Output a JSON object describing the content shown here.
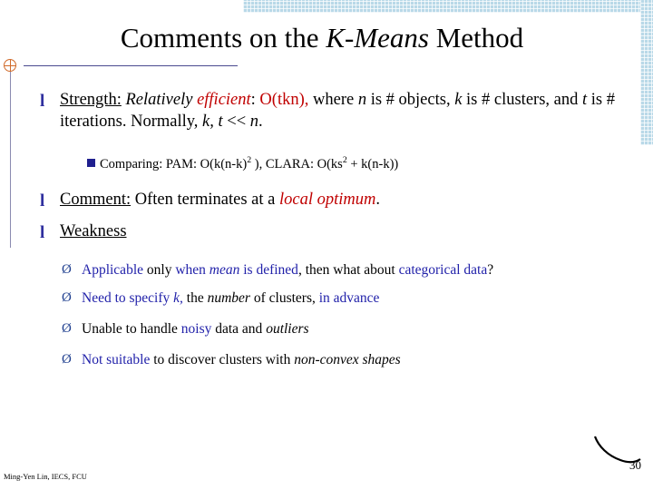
{
  "slide": {
    "title": {
      "part1": "Comments on the ",
      "part2_italic": "K-Means",
      "part3": " Method"
    },
    "bullets": [
      {
        "marker": "l",
        "segments": [
          {
            "text": "Strength:",
            "style": "underline"
          },
          {
            "text": " ",
            "style": "plain"
          },
          {
            "text": "Relatively",
            "style": "italic"
          },
          {
            "text": " ",
            "style": "plain"
          },
          {
            "text": "efficient",
            "style": "italic-red"
          },
          {
            "text": ": ",
            "style": "plain"
          },
          {
            "text": "O(tkn),",
            "style": "red"
          },
          {
            "text": " where ",
            "style": "plain"
          },
          {
            "text": "n",
            "style": "italic"
          },
          {
            "text": " is # objects, ",
            "style": "plain"
          },
          {
            "text": "k",
            "style": "italic"
          },
          {
            "text": " is # clusters, and ",
            "style": "plain"
          },
          {
            "text": "t",
            "style": "italic"
          },
          {
            "text": "  is # iterations. Normally, ",
            "style": "plain"
          },
          {
            "text": "k, t",
            "style": "italic"
          },
          {
            "text": " << ",
            "style": "plain"
          },
          {
            "text": "n",
            "style": "italic"
          },
          {
            "text": ".",
            "style": "plain"
          }
        ]
      }
    ],
    "sub_bullet": {
      "marker": "n",
      "text_before": "Comparing: PAM: O(k(n-k)",
      "exponent": "2",
      "text_mid": " ), CLARA: O(ks",
      "exponent2": "2",
      "text_after": " + k(n-k))"
    },
    "comment_bullet": {
      "marker": "l",
      "label": "Comment:",
      "text": " Often terminates at a ",
      "emphasis": "local optimum",
      "period": "."
    },
    "weakness_bullet": {
      "marker": "l",
      "label": "Weakness"
    },
    "weakness_items": [
      {
        "marker": "Ø",
        "segments": [
          {
            "text": "Applicable",
            "style": "blue"
          },
          {
            "text": " only ",
            "style": "dark"
          },
          {
            "text": "when",
            "style": "blue"
          },
          {
            "text": " ",
            "style": "dark"
          },
          {
            "text": "mean",
            "style": "italic-blue"
          },
          {
            "text": " ",
            "style": "dark"
          },
          {
            "text": "is defined",
            "style": "blue"
          },
          {
            "text": ", then what about ",
            "style": "dark"
          },
          {
            "text": "categorical data",
            "style": "blue"
          },
          {
            "text": "?",
            "style": "dark"
          }
        ]
      },
      {
        "marker": "Ø",
        "segments": [
          {
            "text": "Need to specify ",
            "style": "blue"
          },
          {
            "text": "k,",
            "style": "italic-blue"
          },
          {
            "text": " the ",
            "style": "dark"
          },
          {
            "text": "number",
            "style": "italic-dark"
          },
          {
            "text": " of clusters, ",
            "style": "dark"
          },
          {
            "text": "in advance",
            "style": "blue"
          }
        ]
      },
      {
        "marker": "Ø",
        "segments": [
          {
            "text": "Unable to handle ",
            "style": "dark"
          },
          {
            "text": "noisy",
            "style": "blue"
          },
          {
            "text": " data and ",
            "style": "dark"
          },
          {
            "text": "outliers",
            "style": "italic-dark"
          }
        ]
      },
      {
        "marker": "Ø",
        "segments": [
          {
            "text": "Not",
            "style": "blue"
          },
          {
            "text": " ",
            "style": "dark"
          },
          {
            "text": "suitable",
            "style": "blue"
          },
          {
            "text": " to discover clusters with ",
            "style": "dark"
          },
          {
            "text": "non-convex shapes",
            "style": "italic-dark"
          }
        ]
      }
    ],
    "footer": {
      "author": "Ming-Yen Lin, IECS, FCU",
      "page_number": "30"
    },
    "colors": {
      "band": "#b9d9e8",
      "bullet_blue": "#2f2f9e",
      "accent_red": "#c00000",
      "rule": "#4a4a8f",
      "plus_mark": "#d06a2a"
    }
  }
}
